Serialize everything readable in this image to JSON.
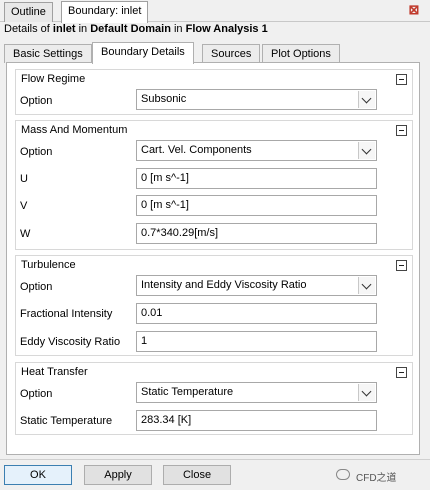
{
  "top_tabs": [
    {
      "label": "Outline"
    },
    {
      "label": "Boundary: inlet"
    }
  ],
  "details": {
    "prefix": "Details of ",
    "object": "inlet",
    "in1": " in ",
    "domain": "Default Domain",
    "in2": " in ",
    "analysis": "Flow Analysis 1"
  },
  "sub_tabs": [
    {
      "label": "Basic Settings"
    },
    {
      "label": "Boundary Details"
    },
    {
      "label": "Sources"
    },
    {
      "label": "Plot Options"
    }
  ],
  "flow_regime": {
    "title": "Flow Regime",
    "option_label": "Option",
    "option_value": "Subsonic"
  },
  "mass_momentum": {
    "title": "Mass And Momentum",
    "option_label": "Option",
    "option_value": "Cart. Vel. Components",
    "u_label": "U",
    "u_value": "0 [m s^-1]",
    "v_label": "V",
    "v_value": "0 [m s^-1]",
    "w_label": "W",
    "w_value": "0.7*340.29[m/s]"
  },
  "turbulence": {
    "title": "Turbulence",
    "option_label": "Option",
    "option_value": "Intensity and Eddy Viscosity Ratio",
    "fi_label": "Fractional Intensity",
    "fi_value": "0.01",
    "evr_label": "Eddy Viscosity Ratio",
    "evr_value": "1"
  },
  "heat_transfer": {
    "title": "Heat Transfer",
    "option_label": "Option",
    "option_value": "Static Temperature",
    "st_label": "Static Temperature",
    "st_value": "283.34 [K]"
  },
  "buttons": {
    "ok": "OK",
    "apply": "Apply",
    "close": "Close"
  },
  "watermark": "CFD之道"
}
